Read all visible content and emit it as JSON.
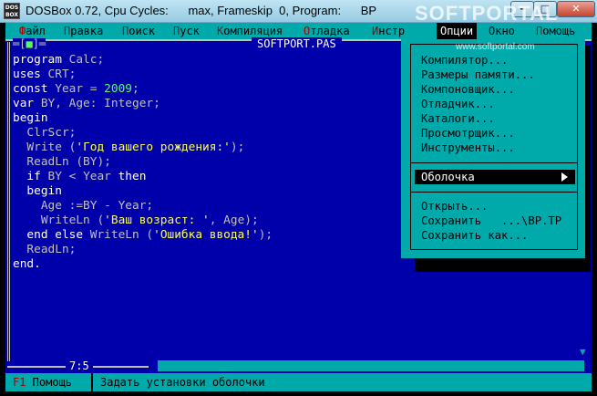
{
  "window": {
    "title": "DOSBox 0.72, Cpu Cycles:      max, Frameskip  0, Program:      BP",
    "icon_text": "DOS BOX",
    "min_symbol": "–",
    "max_symbol": "□",
    "close_symbol": "✕",
    "watermark": "SOFTPORTAL",
    "watermark_url": "www.softportal.com"
  },
  "menubar": {
    "items": [
      {
        "hotkey": "Ф",
        "rest": "айл"
      },
      {
        "hotkey": "П",
        "rest": "равка"
      },
      {
        "hotkey": "П",
        "rest": "оиск"
      },
      {
        "hotkey": "П",
        "rest": "уск"
      },
      {
        "hotkey": "К",
        "rest": "омпиляция"
      },
      {
        "hotkey": "О",
        "rest": "тладка"
      },
      {
        "hotkey": "И",
        "rest": "нстр"
      },
      {
        "hotkey": "О",
        "rest": "пции"
      },
      {
        "hotkey": "",
        "rest": "Окно"
      },
      {
        "hotkey": "П",
        "rest": "омощь"
      }
    ]
  },
  "editor": {
    "close_box_left": "═[",
    "close_box_mark": "■",
    "close_box_right": "]═",
    "file_name": "SOFTPORT.PAS",
    "cursor_pos": "7:5",
    "code": [
      {
        "indent": "",
        "tokens": [
          {
            "t": "kw",
            "v": "program "
          },
          {
            "t": "op",
            "v": "Calc;"
          }
        ]
      },
      {
        "indent": "",
        "tokens": [
          {
            "t": "kw",
            "v": "uses "
          },
          {
            "t": "op",
            "v": "CRT;"
          }
        ]
      },
      {
        "indent": "",
        "tokens": [
          {
            "t": "kw",
            "v": "const "
          },
          {
            "t": "op",
            "v": "Year = "
          },
          {
            "t": "num",
            "v": "2009"
          },
          {
            "t": "op",
            "v": ";"
          }
        ]
      },
      {
        "indent": "",
        "tokens": [
          {
            "t": "kw",
            "v": "var "
          },
          {
            "t": "op",
            "v": "BY, Age: Integer;"
          }
        ]
      },
      {
        "indent": "",
        "tokens": [
          {
            "t": "kw",
            "v": "begin"
          }
        ]
      },
      {
        "indent": "  ",
        "tokens": [
          {
            "t": "op",
            "v": "ClrScr;"
          }
        ]
      },
      {
        "indent": "  ",
        "tokens": [
          {
            "t": "op",
            "v": "Write ("
          },
          {
            "t": "str",
            "v": "'Год вашего рождения:'"
          },
          {
            "t": "op",
            "v": ");"
          }
        ]
      },
      {
        "indent": "  ",
        "tokens": [
          {
            "t": "op",
            "v": "ReadLn (BY);"
          }
        ]
      },
      {
        "indent": "  ",
        "tokens": [
          {
            "t": "kw",
            "v": "if "
          },
          {
            "t": "op",
            "v": "BY < Year "
          },
          {
            "t": "kw",
            "v": "then"
          }
        ]
      },
      {
        "indent": "  ",
        "tokens": [
          {
            "t": "kw",
            "v": "begin"
          }
        ]
      },
      {
        "indent": "    ",
        "tokens": [
          {
            "t": "op",
            "v": "Age :=BY - Year;"
          }
        ]
      },
      {
        "indent": "    ",
        "tokens": [
          {
            "t": "op",
            "v": "WriteLn ("
          },
          {
            "t": "str",
            "v": "'Ваш возраст: '"
          },
          {
            "t": "op",
            "v": ", Age);"
          }
        ]
      },
      {
        "indent": "  ",
        "tokens": [
          {
            "t": "kw",
            "v": "end else "
          },
          {
            "t": "op",
            "v": "WriteLn ("
          },
          {
            "t": "str",
            "v": "'Ошибка ввода!'"
          },
          {
            "t": "op",
            "v": ");"
          }
        ]
      },
      {
        "indent": "  ",
        "tokens": [
          {
            "t": "op",
            "v": "ReadLn;"
          }
        ]
      },
      {
        "indent": "",
        "tokens": [
          {
            "t": "kw",
            "v": "end."
          }
        ]
      }
    ]
  },
  "dropdown": {
    "group1": [
      "Компилятор...",
      "Размеры памяти...",
      "Компоновщик...",
      "Отладчик...",
      "Каталоги...",
      "Просмотрщик...",
      "Инструменты..."
    ],
    "selected": "Оболочка",
    "group3": [
      "Открыть...",
      "Сохранить   ...\\BP.TP",
      "Сохранить как..."
    ]
  },
  "statusbar": {
    "f1_key": "F1",
    "f1_label": " Помощь",
    "hint": "Задать установки оболочки"
  },
  "colors": {
    "dos_blue": "#0000aa",
    "dos_cyan": "#00aaaa",
    "dos_red": "#aa0000",
    "code_string": "#ffff55",
    "code_number": "#55ff55"
  }
}
